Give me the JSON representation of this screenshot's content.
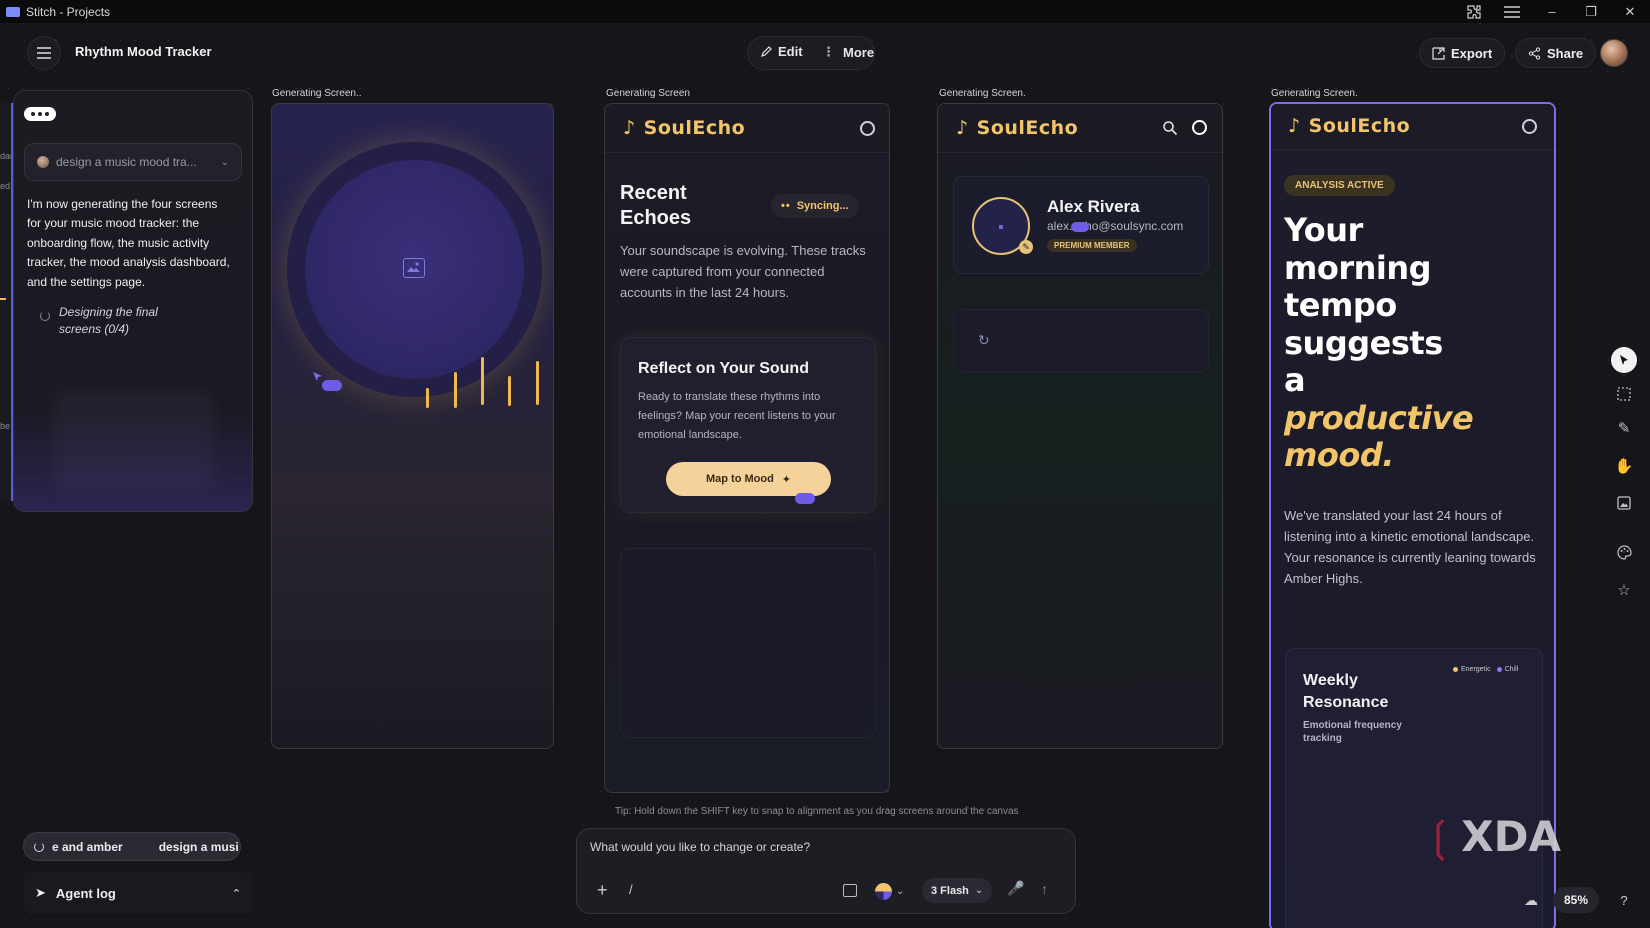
{
  "window": {
    "title": "Stitch - Projects"
  },
  "header": {
    "project_title": "Rhythm Mood Tracker",
    "edit_label": "Edit",
    "more_label": "More",
    "export_label": "Export",
    "share_label": "Share"
  },
  "chat": {
    "prompt_chip": "design a music mood tra...",
    "message": "I'm now generating the four screens for your music mood tracker: the onboarding flow, the music activity tracker, the mood analysis dashboard, and the settings page.",
    "status": "Designing the final screens (0/4)",
    "left_stub_lines": [
      "dar",
      "ed",
      "",
      "",
      "",
      "be"
    ]
  },
  "bottom_left": {
    "pill_left": "e and amber",
    "pill_right": "design a musi",
    "agent_log_label": "Agent log"
  },
  "screens": [
    {
      "label": "Generating Screen.."
    },
    {
      "label": "Generating Screen",
      "logo": "SoulEcho",
      "title": "Recent Echoes",
      "sync_badge": "Syncing...",
      "description": "Your soundscape is evolving. These tracks were captured from your connected accounts in the last 24 hours.",
      "card_title": "Reflect on Your Sound",
      "card_text": "Ready to translate these rhythms into feelings? Map your recent listens to your emotional landscape.",
      "cta": "Map to Mood"
    },
    {
      "label": "Generating Screen.",
      "logo": "SoulEcho",
      "profile_name": "Alex Rivera",
      "profile_email": "alex.echo@soulsync.com",
      "badge": "PREMIUM MEMBER"
    },
    {
      "label": "Generating Screen.",
      "logo": "SoulEcho",
      "status_badge": "ANALYSIS ACTIVE",
      "headline_1": "Your",
      "headline_2": "morning",
      "headline_3": "tempo",
      "headline_4": "suggests",
      "headline_5": "a",
      "headline_6": "productive",
      "headline_7": "mood.",
      "description": "We've translated your last 24 hours of listening into a kinetic emotional landscape. Your resonance is currently leaning towards Amber Highs.",
      "card_title_1": "Weekly",
      "card_title_2": "Resonance",
      "card_subtitle": "Emotional frequency tracking",
      "legend_energetic": "Energetic",
      "legend_chill": "Chill"
    }
  ],
  "canvas": {
    "tip": "Tip: Hold down the SHIFT key to snap to alignment as you drag screens around the canvas",
    "zoom": "85%",
    "watermark": "XDA"
  },
  "composer": {
    "placeholder": "What would you like to change or create?",
    "slash": "/",
    "model_label": "3 Flash"
  },
  "colors": {
    "accent": "#6c5ce7",
    "amber": "#f2c56a",
    "frame_selected": "#7c6cf0"
  }
}
